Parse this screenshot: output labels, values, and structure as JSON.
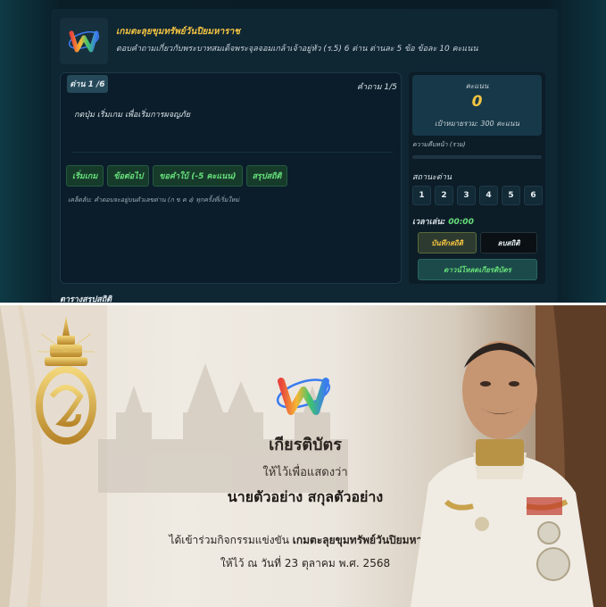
{
  "game": {
    "title": "เกมตะลุยขุมทรัพย์วันปิยมหาราช",
    "description": "ตอบคำถามเกี่ยวกับพระบาทสมเด็จพระจุลจอมเกล้าเจ้าอยู่หัว (ร.5) 6 ด่าน ด่านละ 5 ข้อ ข้อละ 10 คะแนน"
  },
  "question": {
    "set_badge": "ด่าน 1 /6",
    "counter": "คำถาม 1/5",
    "prompt": "กดปุ่ม เริ่มเกม เพื่อเริ่มการผจญภัย",
    "hint": "เคล็ดลับ: คำตอบจะอยู่บนตัวเลขด่าน (ก ข ค ง) ทุกครั้งที่เริ่มใหม่"
  },
  "buttons": {
    "start": "เริ่มเกม",
    "next": "ข้อต่อไป",
    "hint": "ขอคำใบ้ (-5 คะแนน)",
    "summary": "สรุปสถิติ"
  },
  "score": {
    "label": "คะแนน",
    "value": "0",
    "target": "เป้าหมายรวม: 300 คะแนน"
  },
  "progress": {
    "label": "ความคืบหน้า (รวม)",
    "fraction": 0.0
  },
  "status": {
    "label": "สถานะด่าน",
    "sets": [
      "1",
      "2",
      "3",
      "4",
      "5",
      "6"
    ]
  },
  "time": {
    "label": "เวลาเล่น:",
    "value": "00:00"
  },
  "actions": {
    "save": "บันทึกสถิติ",
    "reset": "ลบสถิติ",
    "download": "ดาวน์โหลดเกียรติบัตร"
  },
  "summary_heading": "ตารางสรุปสถิติ",
  "certificate": {
    "title": "เกียรติบัตร",
    "subtitle": "ให้ไว้เพื่อแสดงว่า",
    "name": "นายตัวอย่าง สกุลตัวอย่าง",
    "line1_prefix": "ได้เข้าร่วมกิจกรรมแข่งขัน",
    "line1_event": "เกมตะลุยขุมทรัพย์วันปิยมหาราช",
    "line2": "ให้ไว้ ณ วันที่ 23 ตุลาคม พ.ศ. 2568"
  },
  "colors": {
    "accent_gold": "#f4c542",
    "accent_green": "#66e07a",
    "panel_bg": "#0f2633"
  }
}
